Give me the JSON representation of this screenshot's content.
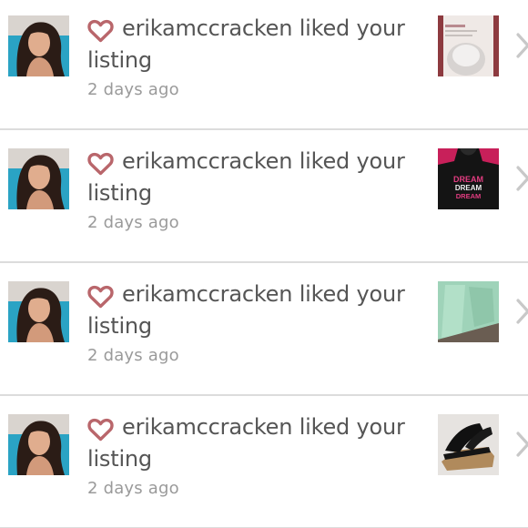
{
  "notifications": [
    {
      "username": "erikamccracken",
      "action": "liked your listing",
      "time": "2 days ago",
      "thumbnail": "product-jar"
    },
    {
      "username": "erikamccracken",
      "action": "liked your listing",
      "time": "2 days ago",
      "thumbnail": "dream-shirt"
    },
    {
      "username": "erikamccracken",
      "action": "liked your listing",
      "time": "2 days ago",
      "thumbnail": "mint-pants"
    },
    {
      "username": "erikamccracken",
      "action": "liked your listing",
      "time": "2 days ago",
      "thumbnail": "black-wedge-sandals"
    }
  ],
  "thumb_text": {
    "shirt_line1": "DREAM",
    "shirt_line2": "DREAM",
    "shirt_line3": "DREAM"
  },
  "colors": {
    "heart": "#b9666b",
    "text": "#555555",
    "time": "#9a9a9a",
    "divider": "#dcdcdc",
    "chevron": "#c8c8c8"
  },
  "icons": {
    "like": "heart-icon",
    "chevron": "chevron-right-icon"
  }
}
